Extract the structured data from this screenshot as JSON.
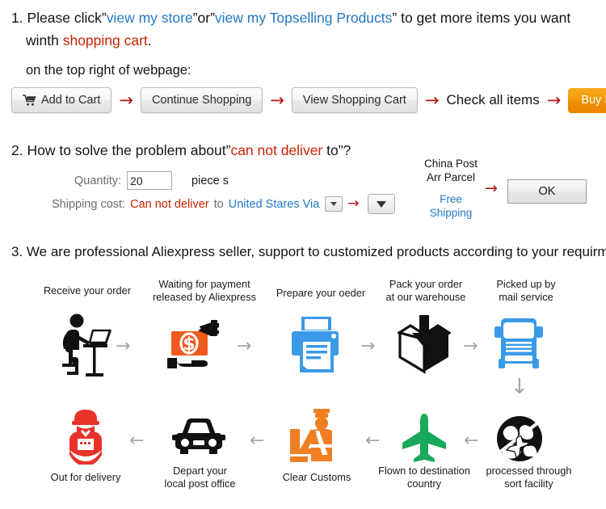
{
  "section1": {
    "number": "1.",
    "line1_a": "Please click”",
    "link_store": "view my store",
    "line1_b": "”or”",
    "link_top": "view my Topselling Products",
    "line1_c": "” to get more items you want",
    "line2_a": "winth ",
    "line2_red": "shopping cart",
    "line2_b": ".",
    "subtitle": "on the top right of webpage:",
    "buttons": {
      "add_to_cart": "Add to Cart",
      "continue_shopping": "Continue Shopping",
      "view_shopping_cart": "View Shopping Cart",
      "check_all_items": "Check all items",
      "buy_now": "Buy Now"
    },
    "arrow": "→"
  },
  "section2": {
    "number": "2.",
    "title_a": "How to solve the problem about”",
    "title_red": "can not deliver",
    "title_b": " to”?",
    "quantity_label": "Quantity:",
    "quantity_value": "20",
    "piece_label": "piece s",
    "shipping_label": "Shipping cost:",
    "shipping_red": "Can not deliver",
    "shipping_to": " to ",
    "shipping_country": "United Stares Via",
    "carrier_line1": "China Post",
    "carrier_line2": "Arr Parcel",
    "free_line1": "Free",
    "free_line2": "Shipping",
    "ok_label": "OK",
    "arrow": "→"
  },
  "section3": {
    "number": "3.",
    "title": "We are professional Aliexpress seller, support to customized products according to your requirment.",
    "steps": [
      {
        "label": "Receive your order",
        "icon": "person-at-desk-icon"
      },
      {
        "label": "Waiting for payment\nreleased by Aliexpress",
        "icon": "money-handoff-icon"
      },
      {
        "label": "Prepare your oeder",
        "icon": "printer-icon"
      },
      {
        "label": "Pack your order\nat our warehouse",
        "icon": "box-packing-icon"
      },
      {
        "label": "Picked up by\nmail service",
        "icon": "truck-icon"
      },
      {
        "label": "processed through\nsort facility",
        "icon": "globe-plane-icon"
      },
      {
        "label": "Flown to destination\ncountry",
        "icon": "airplane-icon"
      },
      {
        "label": "Clear Customs",
        "icon": "customs-officer-icon"
      },
      {
        "label": "Depart your\nlocal post office",
        "icon": "car-icon"
      },
      {
        "label": "Out for delivery",
        "icon": "delivery-person-icon"
      }
    ],
    "arrow_right": "→",
    "arrow_left": "←",
    "arrow_down": "↓"
  },
  "colors": {
    "link_blue": "#2277c4",
    "alert_red": "#cc2200",
    "arrow_red": "#b41414",
    "buy_orange": "#ef8f02",
    "icon_blue": "#3a9ae8",
    "icon_orange": "#ef7f22",
    "icon_green": "#1aa85c",
    "icon_red": "#e8332a",
    "arrow_grey": "#a6a6a6"
  }
}
